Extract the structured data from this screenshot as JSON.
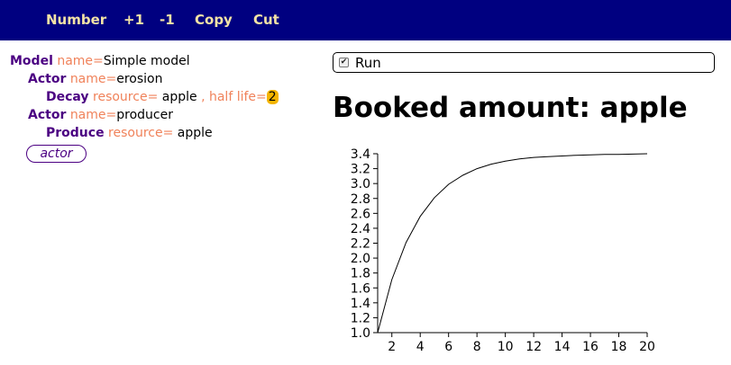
{
  "toolbar": {
    "buttons": [
      "Number",
      "+1",
      "-1",
      "Copy",
      "Cut"
    ],
    "background": "#000080",
    "text_color": "#f3e3a6"
  },
  "tree": {
    "model": {
      "keyword": "Model",
      "name_attr": "name=",
      "name": "Simple model"
    },
    "actor1": {
      "keyword": "Actor",
      "name_attr": "name=",
      "name": "erosion"
    },
    "decay": {
      "keyword": "Decay",
      "resource_attr": "resource=",
      "resource": "apple",
      "sep": ",",
      "halflife_attr": "half life=",
      "halflife": "2"
    },
    "actor2": {
      "keyword": "Actor",
      "name_attr": "name=",
      "name": "producer"
    },
    "produce": {
      "keyword": "Produce",
      "resource_attr": "resource=",
      "resource": "apple"
    },
    "add_actor_label": "actor",
    "colors": {
      "keyword": "#4b0082",
      "attribute": "#f0825a",
      "highlight": "#f5b400"
    }
  },
  "run": {
    "label": "Run",
    "checked": true
  },
  "heading": "Booked amount: apple",
  "chart_data": {
    "type": "line",
    "title": "",
    "xlabel": "",
    "ylabel": "",
    "xlim": [
      1,
      20
    ],
    "ylim": [
      1.0,
      3.4
    ],
    "xticks": [
      "2",
      "4",
      "6",
      "8",
      "10",
      "12",
      "14",
      "16",
      "18",
      "20"
    ],
    "yticks": [
      "1.0",
      "1.2",
      "1.4",
      "1.6",
      "1.8",
      "2.0",
      "2.2",
      "2.4",
      "2.6",
      "2.8",
      "3.0",
      "3.2",
      "3.4"
    ],
    "grid": false,
    "series": [
      {
        "x": [
          1,
          2,
          3,
          4,
          5,
          6,
          7,
          8,
          9,
          10,
          11,
          12,
          13,
          14,
          15,
          16,
          17,
          18,
          19,
          20
        ],
        "values": [
          1.0,
          1.71,
          2.21,
          2.56,
          2.81,
          2.99,
          3.11,
          3.2,
          3.26,
          3.3,
          3.33,
          3.35,
          3.36,
          3.37,
          3.38,
          3.385,
          3.39,
          3.39,
          3.395,
          3.4
        ],
        "color": "#000000"
      }
    ]
  }
}
